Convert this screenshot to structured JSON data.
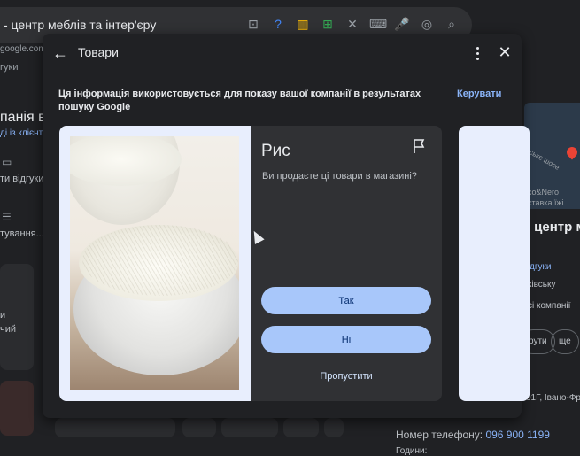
{
  "background": {
    "search_query": "- центр меблів та інтер'єру",
    "url": "google.com",
    "chip": "гуки",
    "heading": "панія в",
    "sub": "ді із клієнт",
    "left_items": [
      "ти відгуки",
      "тування..."
    ],
    "left_misc": [
      "и",
      "чий"
    ],
    "right_title": "- центр м",
    "right_link": "дгуки",
    "right_lines": [
      "ківську",
      "сі компанії"
    ],
    "pills": [
      "рути",
      "ще"
    ],
    "map_labels": [
      "ське шосе",
      "co&Nero",
      "ставка їжі"
    ],
    "address": "01Г, Івано-Фр",
    "phone_label": "Номер телефону:",
    "phone_value": "096 900 1199",
    "hours_label": "Години:"
  },
  "dialog": {
    "title": "Товари",
    "info": "Ця інформація використовується для показу вашої компанії в результатах пошуку Google",
    "manage": "Керувати",
    "card": {
      "title": "Рис",
      "question": "Ви продаєте ці товари в магазині?",
      "yes": "Так",
      "no": "Ні",
      "skip": "Пропустити"
    }
  }
}
